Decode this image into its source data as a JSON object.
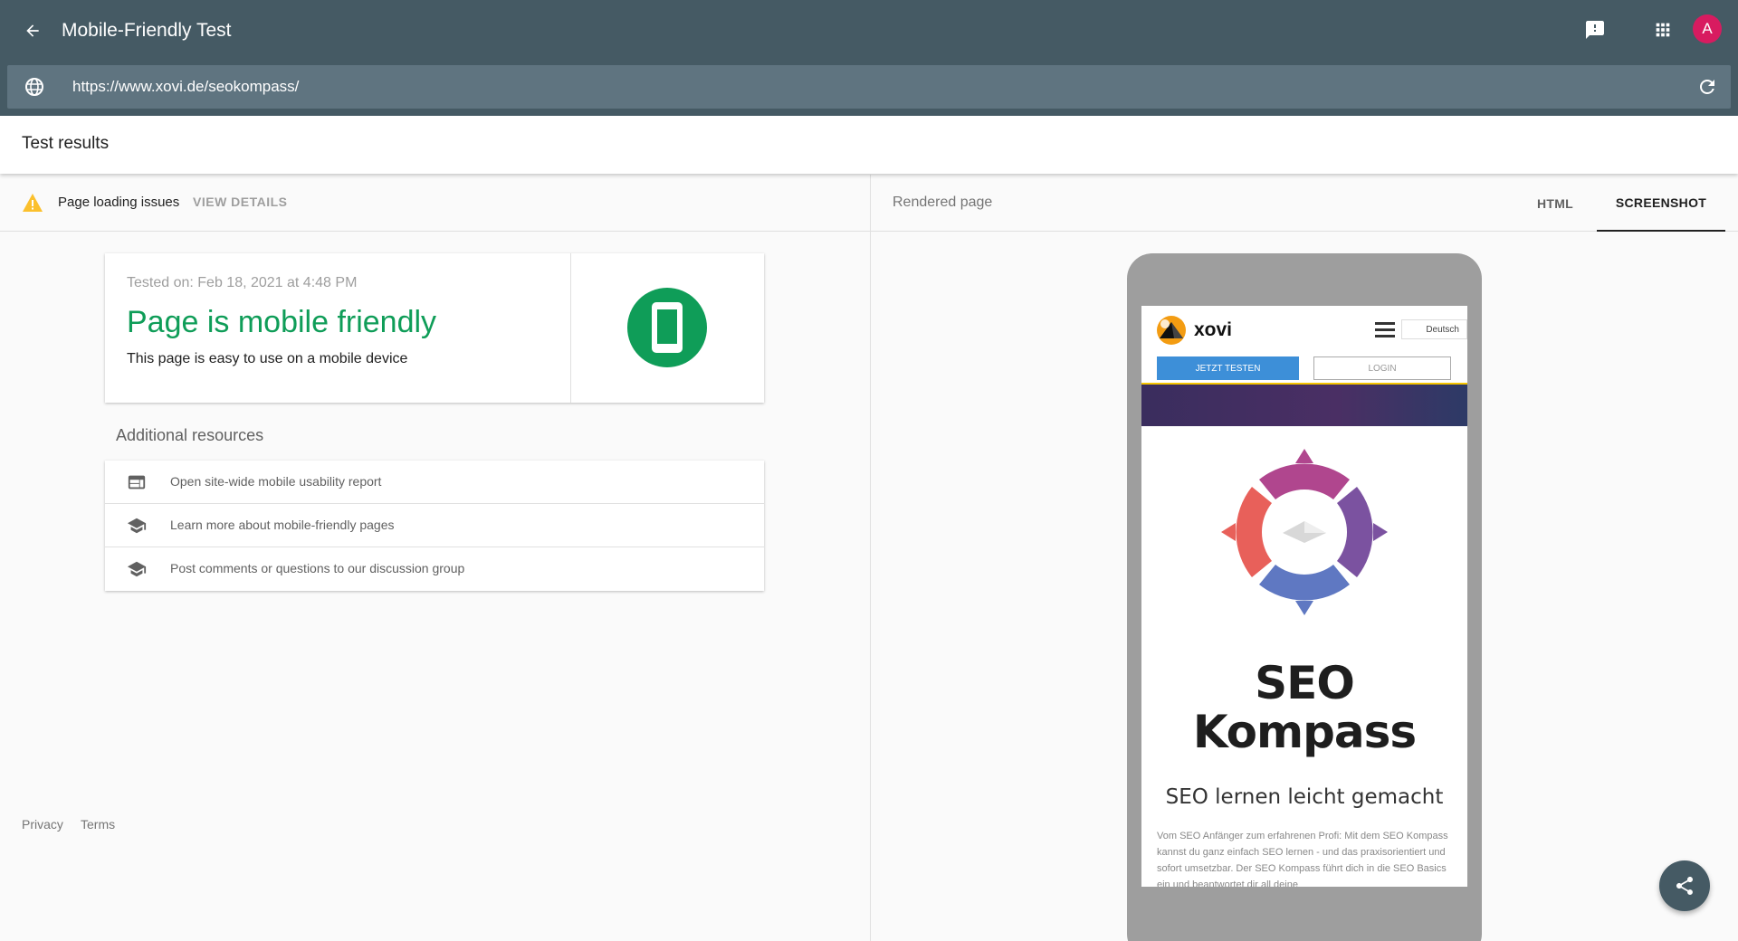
{
  "header": {
    "title": "Mobile-Friendly Test",
    "avatar_letter": "A",
    "url_value": "https://www.xovi.de/seokompass/"
  },
  "results": {
    "title": "Test results"
  },
  "issues": {
    "text": "Page loading issues",
    "action": "VIEW DETAILS"
  },
  "result_card": {
    "tested_on": "Tested on: Feb 18, 2021 at 4:48 PM",
    "verdict": "Page is mobile friendly",
    "subtitle": "This page is easy to use on a mobile device"
  },
  "additional": {
    "title": "Additional resources",
    "items": [
      {
        "label": "Open site-wide mobile usability report",
        "icon": "browser-window-icon"
      },
      {
        "label": "Learn more about mobile-friendly pages",
        "icon": "graduation-cap-icon"
      },
      {
        "label": "Post comments or questions to our discussion group",
        "icon": "graduation-cap-icon"
      }
    ]
  },
  "footer": {
    "privacy": "Privacy",
    "terms": "Terms"
  },
  "rendered": {
    "title": "Rendered page",
    "tabs": [
      "HTML",
      "SCREENSHOT"
    ],
    "active_tab": "SCREENSHOT"
  },
  "preview": {
    "brand": "xovi",
    "language": "Deutsch",
    "cta_primary": "JETZT TESTEN",
    "cta_secondary": "LOGIN",
    "headline_line1": "SEO",
    "headline_line2": "Kompass",
    "subheadline": "SEO lernen leicht gemacht",
    "paragraph": "Vom SEO Anfänger zum erfahrenen Profi: Mit dem SEO Kompass kannst du ganz einfach SEO lernen - und das praxisorientiert und sofort umsetzbar. Der SEO Kompass führt dich in die SEO Basics ein und beantwortet dir all deine"
  },
  "colors": {
    "appbar": "#455a64",
    "success": "#0f9d58",
    "warning": "#fbc02d",
    "avatar": "#d81b60"
  }
}
